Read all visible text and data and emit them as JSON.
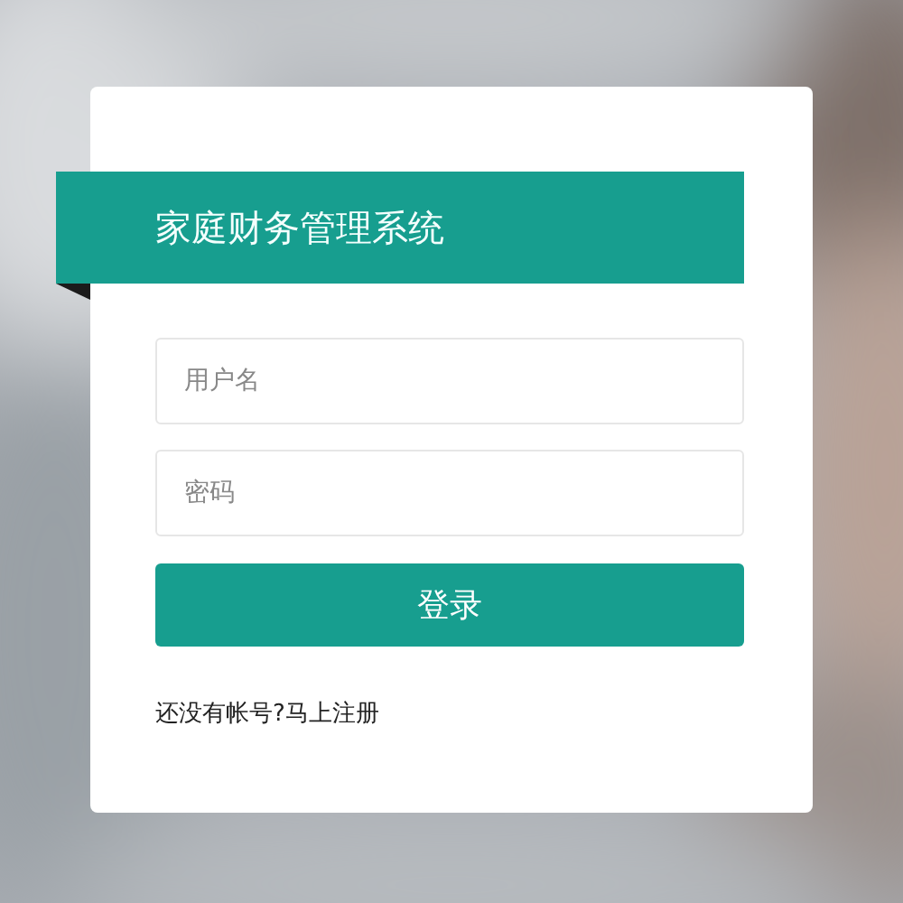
{
  "login_card": {
    "title": "家庭财务管理系统",
    "fields": [
      {
        "placeholder": "用户名"
      },
      {
        "placeholder": "密码"
      }
    ],
    "login_button": "登录",
    "register_link": "还没有帐号?马上注册"
  }
}
